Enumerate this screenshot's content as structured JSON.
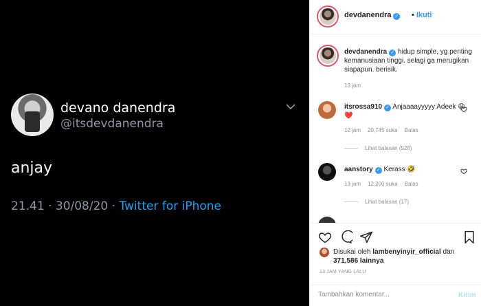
{
  "tweet": {
    "display_name": "devano danendra",
    "handle": "@itsdevdanendra",
    "text": "anjay",
    "time": "21.41 · 30/08/20 · ",
    "source": "Twitter for iPhone"
  },
  "header": {
    "username": "devdanendra",
    "follow_separator": "•",
    "follow_label": "Ikuti"
  },
  "caption": {
    "username": "devdanendra",
    "text": "hidup simple, yg penting kemanusiaan tinggi. selagi ga merugikan siapapun. berisik.",
    "time": "13 jam"
  },
  "comments": [
    {
      "username": "itsrossa910",
      "text": "Anjaaaayyyyy Adeek 😄❤️",
      "time": "12 jam",
      "likes": "20,745 suka",
      "reply_label": "Balas",
      "view_replies": "Lihat balasan (528)"
    },
    {
      "username": "aanstory",
      "text": "Kerass 🤣",
      "time": "13 jam",
      "likes": "12,200 suka",
      "reply_label": "Balas",
      "view_replies": "Lihat balasan (17)"
    }
  ],
  "likes": {
    "prefix": "Disukai oleh ",
    "user": "lambenyinyir_official",
    "middle": " dan ",
    "count": "371,586 lainnya"
  },
  "time_ago": "13 JAM YANG LALU",
  "composer": {
    "placeholder": "Tambahkan komentar...",
    "post_label": "Kirim"
  },
  "colors": {
    "accent": "#3897f0",
    "tweet_link": "#1da1f2",
    "tweet_bg": "#000000"
  }
}
